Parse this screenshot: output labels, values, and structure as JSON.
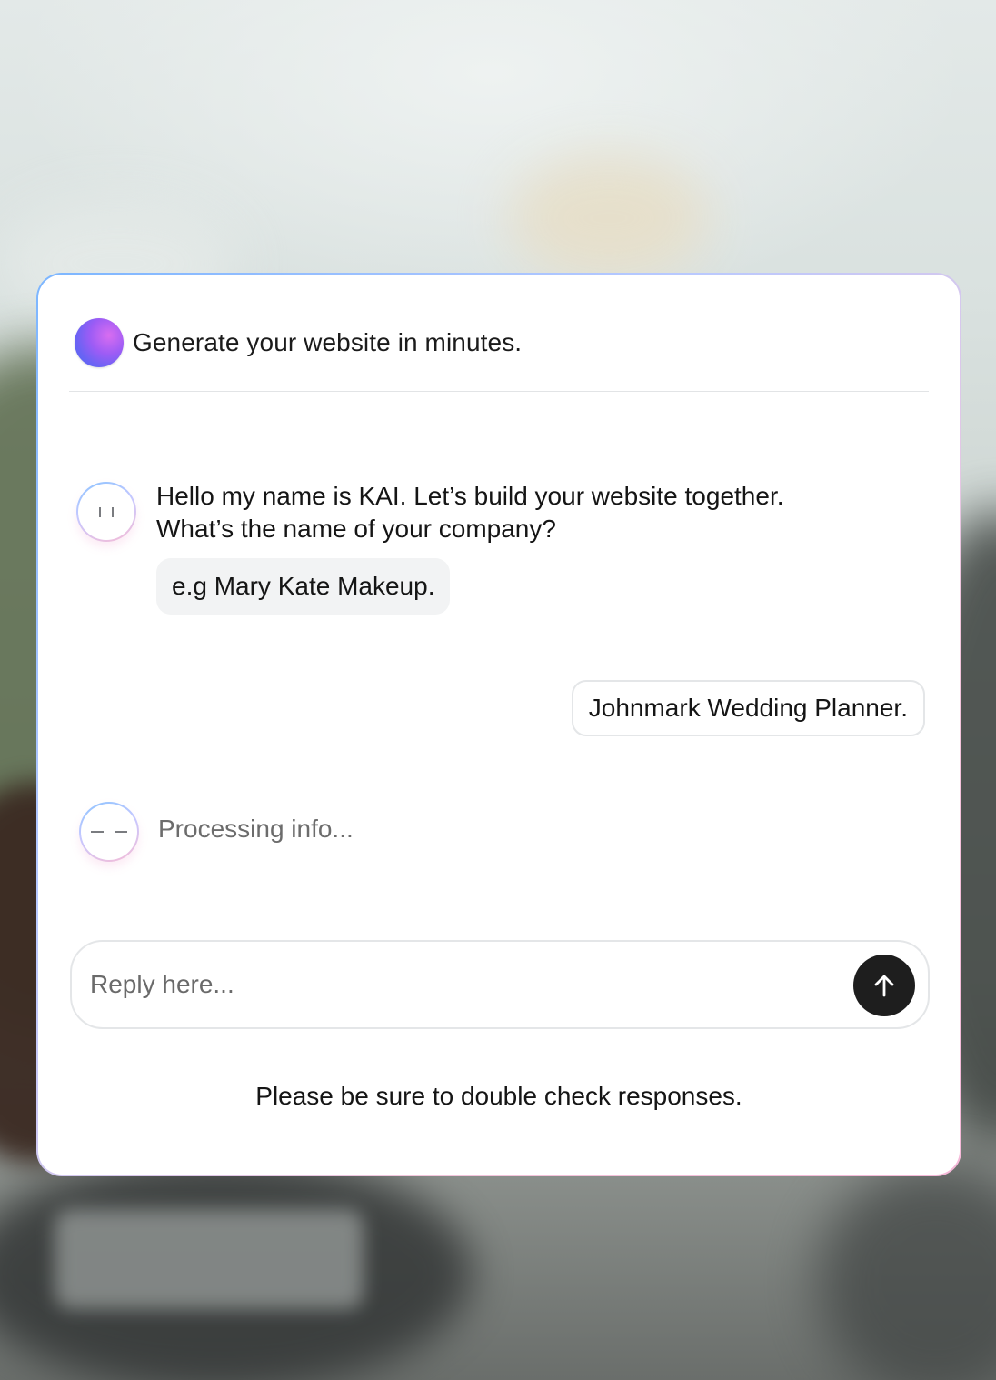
{
  "header": {
    "title": "Generate your website in minutes.",
    "icon": "gradient-orb-icon"
  },
  "conversation": {
    "bot_message": {
      "line1": "Hello my name is KAI. Let’s build your website together.",
      "line2": "What’s the name of your company?"
    },
    "example_hint": "e.g Mary Kate Makeup.",
    "user_message": "Johnmark Wedding Planner.",
    "processing_text": "Processing info..."
  },
  "input": {
    "placeholder": "Reply here...",
    "value": ""
  },
  "footer": {
    "disclaimer": "Please be sure to double check responses."
  },
  "colors": {
    "send_button": "#1e1e1e",
    "orb_start": "#4c67f0",
    "orb_end": "#d86df0",
    "card_border_start": "#7cb6ff",
    "card_border_end": "#f5b8d8"
  }
}
